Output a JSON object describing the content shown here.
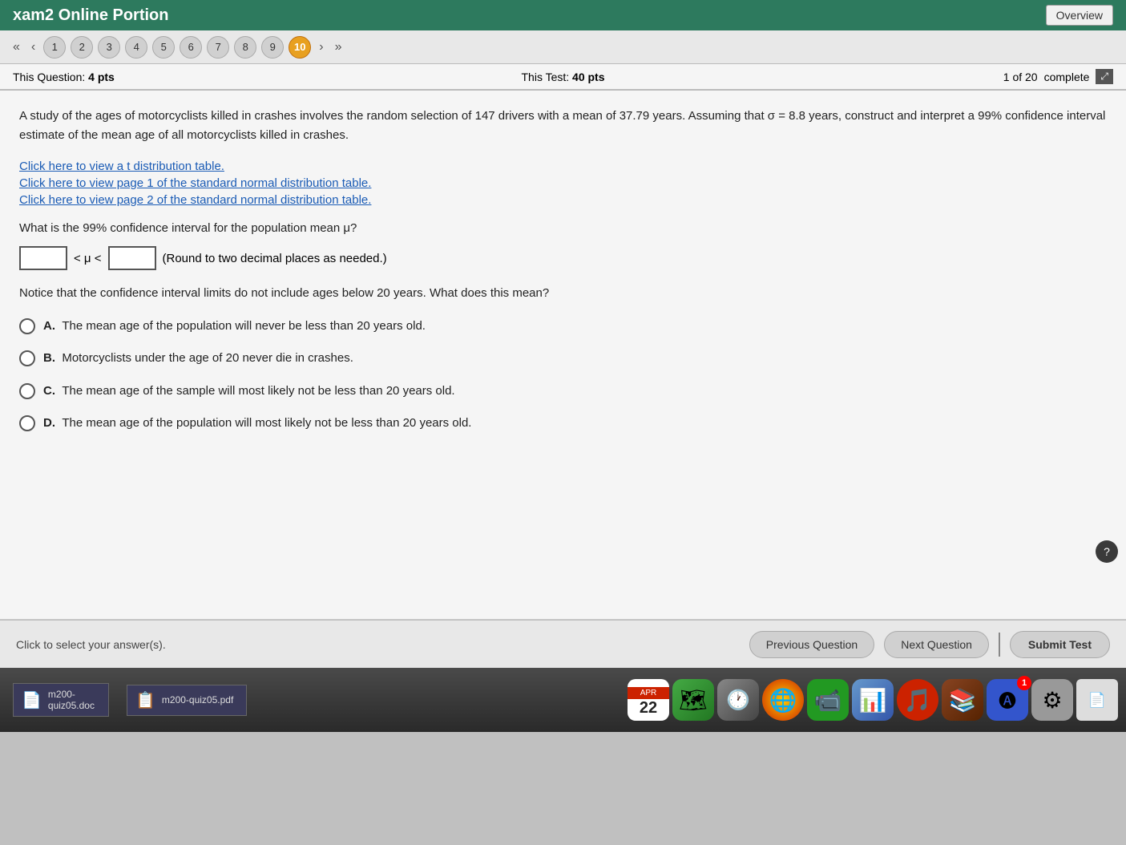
{
  "header": {
    "title": "xam2 Online Portion",
    "overview_label": "Overview"
  },
  "nav": {
    "pages": [
      "1",
      "2",
      "3",
      "4",
      "5",
      "6",
      "7",
      "8",
      "9",
      "10"
    ],
    "active_page": "10",
    "prev_arrow": "‹‹",
    "prev_single": "‹",
    "next_single": "›",
    "next_arrow": "››"
  },
  "info_bar": {
    "question_label": "This Question:",
    "question_pts": "4 pts",
    "test_label": "This Test:",
    "test_pts": "40 pts",
    "progress": "1 of 20",
    "complete_label": "complete"
  },
  "question": {
    "text": "A study of the ages of motorcyclists killed in crashes involves the random selection of 147 drivers with a mean of 37.79 years. Assuming that σ = 8.8 years, construct and interpret a 99% confidence interval estimate of the mean age of all motorcyclists killed in crashes.",
    "links": [
      "Click here to view a t distribution table.",
      "Click here to view page 1 of the standard normal distribution table.",
      "Click here to view page 2 of the standard normal distribution table."
    ],
    "interval_question": "What is the 99% confidence interval for the population mean μ?",
    "interval_symbol": "< μ <",
    "round_note": "(Round to two decimal places as needed.)",
    "notice_text": "Notice that the confidence interval limits do not include ages below 20 years. What does this mean?",
    "options": [
      {
        "label": "A.",
        "text": "The mean age of the population will never be less than 20 years old."
      },
      {
        "label": "B.",
        "text": "Motorcyclists under the age of 20 never die in crashes."
      },
      {
        "label": "C.",
        "text": "The mean age of the sample will most likely not be less than 20 years old."
      },
      {
        "label": "D.",
        "text": "The mean age of the population will most likely not be less than 20 years old."
      }
    ]
  },
  "bottom": {
    "hint": "Click to select your answer(s).",
    "prev_btn": "Previous Question",
    "next_btn": "Next Question",
    "submit_btn": "Submit Test"
  },
  "taskbar": {
    "doc_label": "m200-quiz05.doc",
    "pdf_label": "m200-quiz05.pdf",
    "cal_month": "APR",
    "cal_day": "22"
  }
}
